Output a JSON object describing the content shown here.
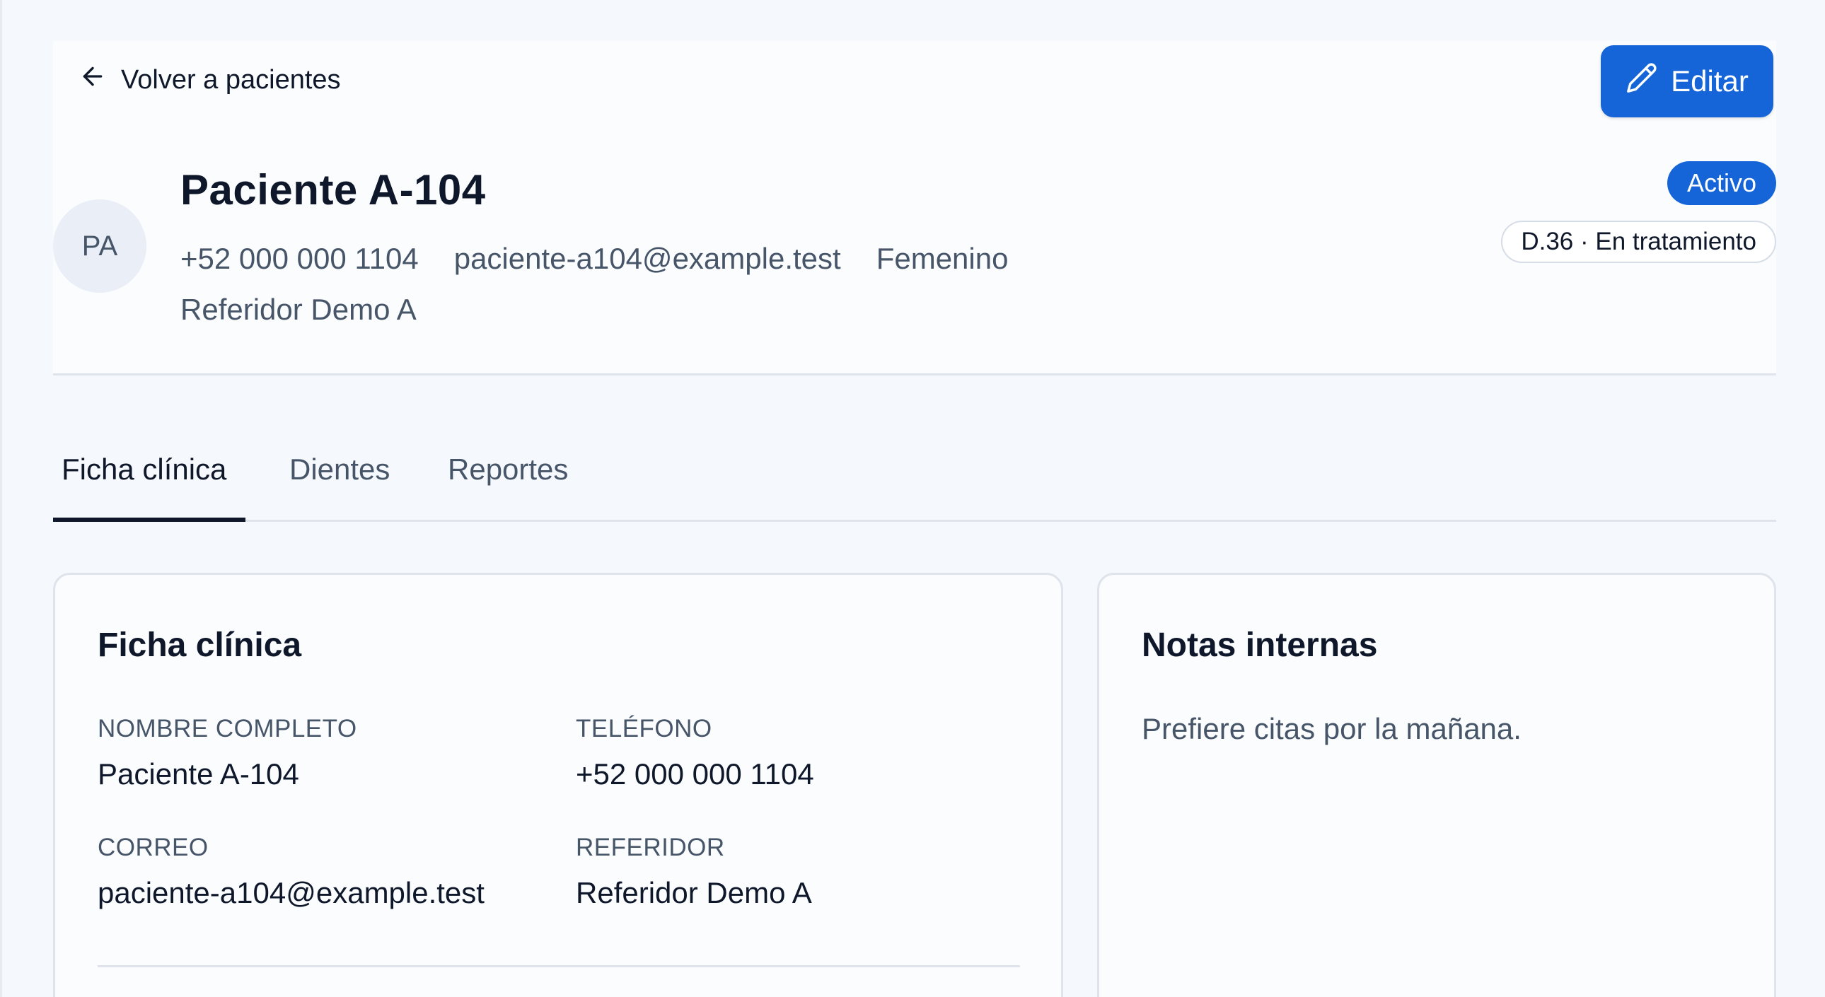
{
  "header": {
    "back_label": "Volver a pacientes",
    "edit_label": "Editar",
    "avatar_initials": "PA",
    "patient_name": "Paciente A-104",
    "phone": "+52 000 000 1104",
    "email": "paciente-a104@example.test",
    "gender": "Femenino",
    "referrer": "Referidor Demo A",
    "status_badge": "Activo",
    "treatment_badge": "D.36 · En tratamiento"
  },
  "tabs": [
    {
      "label": "Ficha clínica",
      "active": true
    },
    {
      "label": "Dientes",
      "active": false
    },
    {
      "label": "Reportes",
      "active": false
    }
  ],
  "clinical_card": {
    "title": "Ficha clínica",
    "fields": [
      {
        "label": "NOMBRE COMPLETO",
        "value": "Paciente A-104"
      },
      {
        "label": "TELÉFONO",
        "value": "+52 000 000 1104"
      },
      {
        "label": "CORREO",
        "value": "paciente-a104@example.test"
      },
      {
        "label": "REFERIDOR",
        "value": "Referidor Demo A"
      }
    ]
  },
  "notes_card": {
    "title": "Notas internas",
    "text": "Prefiere citas por la mañana."
  },
  "colors": {
    "primary": "#1565d8",
    "text": "#0f172a",
    "muted": "#475569",
    "border": "#dfe4ec",
    "background": "#f5f8fc"
  },
  "icons": {
    "back": "arrow-left-icon",
    "edit": "pencil-icon"
  }
}
